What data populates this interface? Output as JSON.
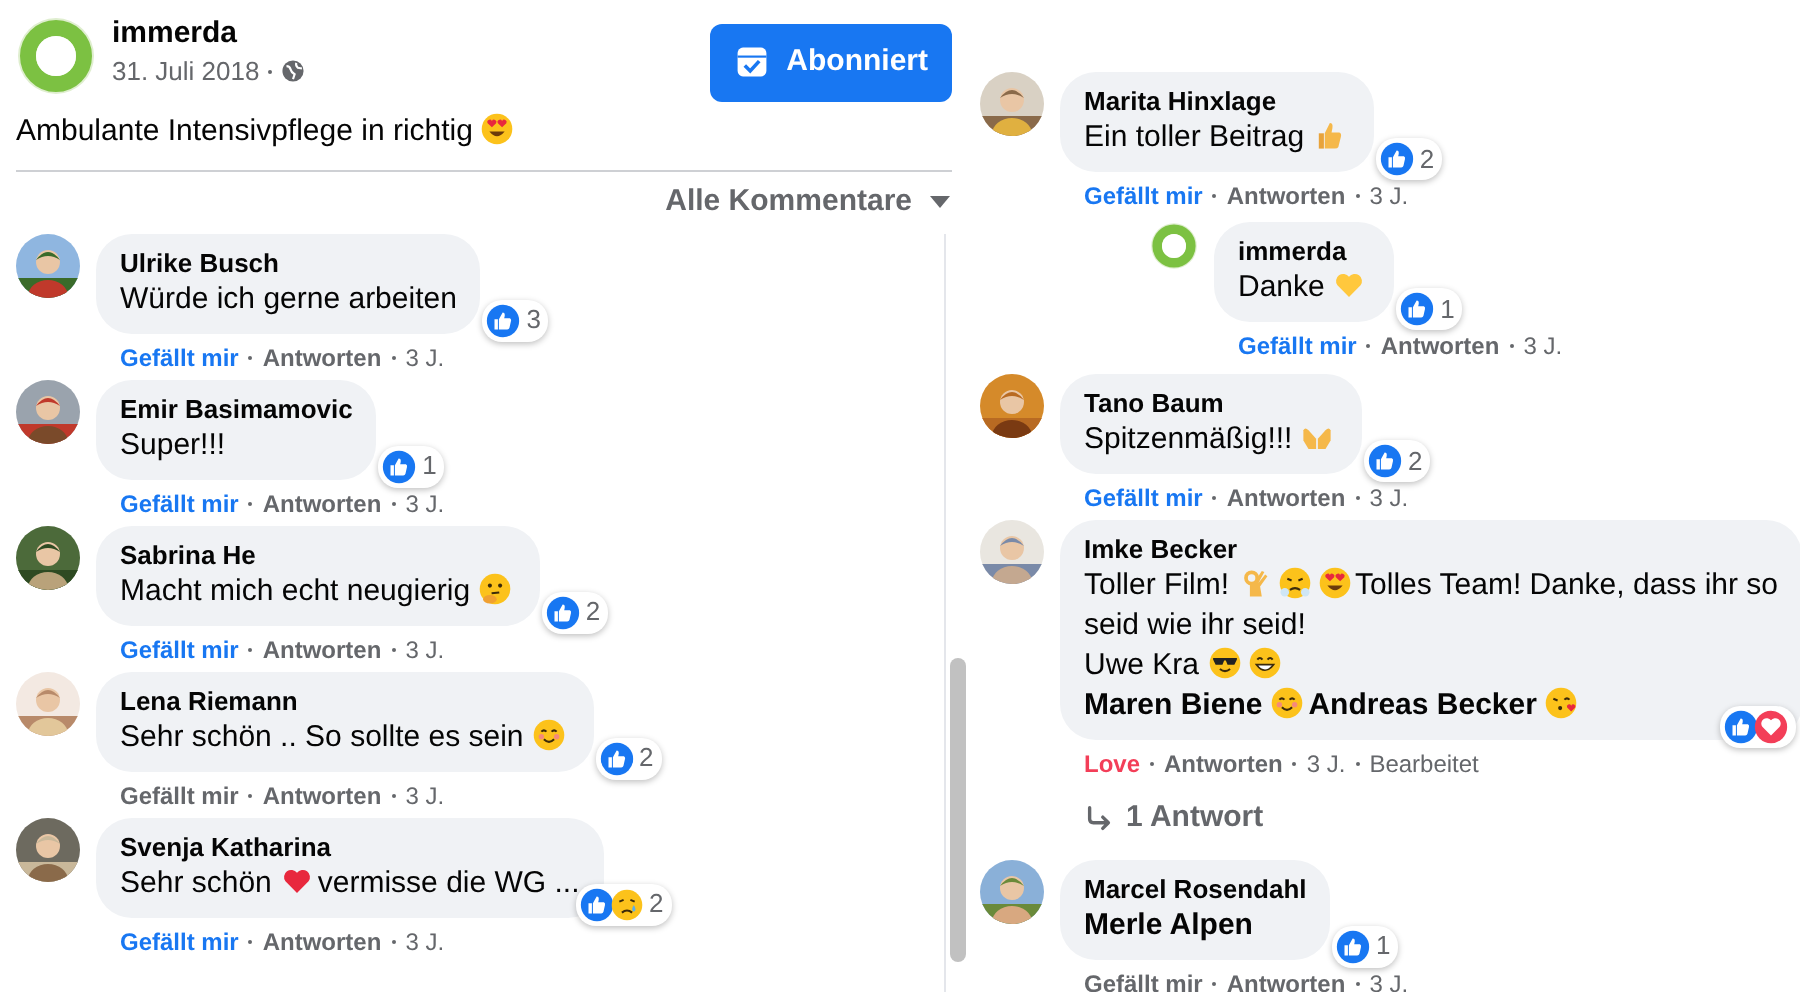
{
  "post": {
    "author": "immerda",
    "avatar": {
      "kind": "logo"
    },
    "date": "31. Juli 2018",
    "follow_button": "Abonniert",
    "body": [
      {
        "kind": "text",
        "text": "Ambulante Intensivpflege in richtig"
      },
      {
        "kind": "hearteyes"
      }
    ]
  },
  "comment_filter": "Alle Kommentare",
  "columns": [
    {
      "comments": [
        {
          "author": "Ulrike Busch",
          "avatar": {
            "kind": "picture"
          },
          "body": [
            {
              "kind": "text",
              "text": "Würde ich gerne arbeiten"
            }
          ],
          "reactions": {
            "types": [
              {
                "kind": "like"
              }
            ],
            "count": "3"
          },
          "react_label": "Gefällt mir",
          "liked": true,
          "loved": false,
          "reply_label": "Antworten",
          "age": "3 J."
        },
        {
          "author": "Emir Basimamovic",
          "avatar": {
            "kind": "picture"
          },
          "body": [
            {
              "kind": "text",
              "text": "Super!!!"
            }
          ],
          "reactions": {
            "types": [
              {
                "kind": "like"
              }
            ],
            "count": "1"
          },
          "react_label": "Gefällt mir",
          "liked": true,
          "loved": false,
          "reply_label": "Antworten",
          "age": "3 J."
        },
        {
          "author": "Sabrina He",
          "avatar": {
            "kind": "picture"
          },
          "body": [
            {
              "kind": "text",
              "text": "Macht mich echt neugierig"
            },
            {
              "kind": "thinking"
            }
          ],
          "reactions": {
            "types": [
              {
                "kind": "like"
              }
            ],
            "count": "2"
          },
          "react_label": "Gefällt mir",
          "liked": true,
          "loved": false,
          "reply_label": "Antworten",
          "age": "3 J."
        },
        {
          "author": "Lena Riemann",
          "avatar": {
            "kind": "picture"
          },
          "body": [
            {
              "kind": "text",
              "text": "Sehr schön .. So sollte es sein"
            },
            {
              "kind": "smiling"
            }
          ],
          "reactions": {
            "types": [
              {
                "kind": "like"
              }
            ],
            "count": "2"
          },
          "react_label": "Gefällt mir",
          "liked": false,
          "loved": false,
          "reply_label": "Antworten",
          "age": "3 J."
        },
        {
          "author": "Svenja Katharina",
          "avatar": {
            "kind": "picture"
          },
          "body": [
            {
              "kind": "text",
              "text": "Sehr schön"
            },
            {
              "kind": "redheart"
            },
            {
              "kind": "text",
              "text": "vermisse die WG ..."
            }
          ],
          "reactions": {
            "types": [
              {
                "kind": "like"
              },
              {
                "kind": "sad"
              }
            ],
            "count": "2"
          },
          "react_label": "Gefällt mir",
          "liked": true,
          "loved": false,
          "reply_label": "Antworten",
          "age": "3 J."
        }
      ]
    },
    {
      "comments": [
        {
          "author": "Marita Hinxlage",
          "avatar": {
            "kind": "picture"
          },
          "body": [
            {
              "kind": "text",
              "text": "Ein toller Beitrag"
            },
            {
              "kind": "thumbsup"
            }
          ],
          "reactions": {
            "types": [
              {
                "kind": "like"
              }
            ],
            "count": "2"
          },
          "react_label": "Gefällt mir",
          "liked": true,
          "loved": false,
          "reply_label": "Antworten",
          "age": "3 J.",
          "children": [
            {
              "author": "immerda",
              "avatar": {
                "kind": "logo"
              },
              "body": [
                {
                  "kind": "text",
                  "text": "Danke"
                },
                {
                  "kind": "yellowheart"
                }
              ],
              "reactions": {
                "types": [
                  {
                    "kind": "like"
                  }
                ],
                "count": "1"
              },
              "react_label": "Gefällt mir",
              "liked": true,
              "loved": false,
              "reply_label": "Antworten",
              "age": "3 J."
            }
          ]
        },
        {
          "author": "Tano Baum",
          "avatar": {
            "kind": "picture"
          },
          "body": [
            {
              "kind": "text",
              "text": "Spitzenmäßig!!!"
            },
            {
              "kind": "raisinghands"
            }
          ],
          "reactions": {
            "types": [
              {
                "kind": "like"
              }
            ],
            "count": "2"
          },
          "react_label": "Gefällt mir",
          "liked": true,
          "loved": false,
          "reply_label": "Antworten",
          "age": "3 J."
        },
        {
          "author": "Imke Becker",
          "avatar": {
            "kind": "picture"
          },
          "body": [
            {
              "kind": "text",
              "text": "Toller Film!"
            },
            {
              "kind": "okhand"
            },
            {
              "kind": "triumph"
            },
            {
              "kind": "hearteyes"
            },
            {
              "kind": "text",
              "text": "Tolles Team! Danke, dass ihr so"
            },
            {
              "kind": "break"
            },
            {
              "kind": "text",
              "text": "seid wie ihr seid!"
            },
            {
              "kind": "break"
            },
            {
              "kind": "text",
              "text": "Uwe Kra"
            },
            {
              "kind": "sunglasses"
            },
            {
              "kind": "grin"
            },
            {
              "kind": "break"
            },
            {
              "kind": "mention",
              "text": "Maren Biene"
            },
            {
              "kind": "smiling"
            },
            {
              "kind": "mention",
              "text": "Andreas Becker"
            },
            {
              "kind": "kiss"
            }
          ],
          "reactions": {
            "types": [
              {
                "kind": "like"
              },
              {
                "kind": "love"
              }
            ]
          },
          "react_label": "Love",
          "liked": false,
          "loved": true,
          "reply_label": "Antworten",
          "age": "3 J.",
          "edited": "Bearbeitet",
          "replies_link": "1 Antwort"
        },
        {
          "author": "Marcel Rosendahl",
          "avatar": {
            "kind": "picture"
          },
          "body": [
            {
              "kind": "mention",
              "text": "Merle Alpen"
            }
          ],
          "reactions": {
            "types": [
              {
                "kind": "like"
              }
            ],
            "count": "1"
          },
          "react_label": "Gefällt mir",
          "liked": false,
          "loved": false,
          "reply_label": "Antworten",
          "age": "3 J."
        }
      ]
    }
  ]
}
